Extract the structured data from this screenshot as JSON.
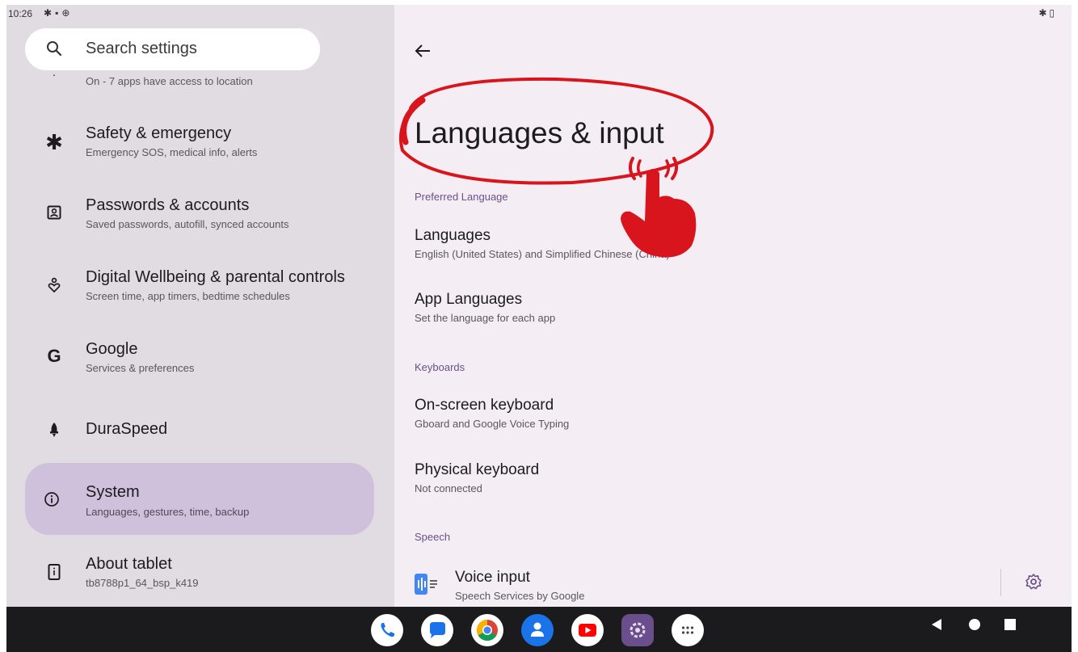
{
  "status_bar": {
    "time": "10:26"
  },
  "search": {
    "placeholder": "Search settings"
  },
  "left_list": {
    "partial_item_sub": "On - 7 apps have access to location",
    "items": [
      {
        "title": "Safety & emergency",
        "subtitle": "Emergency SOS, medical info, alerts",
        "icon": "asterisk-icon"
      },
      {
        "title": "Passwords & accounts",
        "subtitle": "Saved passwords, autofill, synced accounts",
        "icon": "account-box-icon"
      },
      {
        "title": "Digital Wellbeing & parental controls",
        "subtitle": "Screen time, app timers, bedtime schedules",
        "icon": "wellbeing-icon"
      },
      {
        "title": "Google",
        "subtitle": "Services & preferences",
        "icon": "google-icon"
      },
      {
        "title": "DuraSpeed",
        "subtitle": "",
        "icon": "rocket-icon"
      },
      {
        "title": "System",
        "subtitle": "Languages, gestures, time, backup",
        "icon": "info-icon",
        "selected": true
      },
      {
        "title": "About tablet",
        "subtitle": "tb8788p1_64_bsp_k419",
        "icon": "tablet-icon"
      }
    ]
  },
  "right_pane": {
    "title": "Languages & input",
    "sections": [
      {
        "header": "Preferred Language",
        "items": [
          {
            "title": "Languages",
            "subtitle": "English (United States) and Simplified Chinese (China)"
          },
          {
            "title": "App Languages",
            "subtitle": "Set the language for each app"
          }
        ]
      },
      {
        "header": "Keyboards",
        "items": [
          {
            "title": "On-screen keyboard",
            "subtitle": "Gboard and Google Voice Typing"
          },
          {
            "title": "Physical keyboard",
            "subtitle": "Not connected"
          }
        ]
      },
      {
        "header": "Speech",
        "items": [
          {
            "title": "Voice input",
            "subtitle": "Speech Services by Google"
          }
        ]
      }
    ]
  },
  "dock": {
    "apps": [
      "phone-icon",
      "messages-icon",
      "chrome-icon",
      "contacts-icon",
      "youtube-icon",
      "settings-icon",
      "app-drawer-icon"
    ]
  },
  "colors": {
    "left_bg": "#e1dbe2",
    "right_bg": "#f4eef4",
    "selected_bg": "#cfc0dc",
    "section_header": "#6b4f8c",
    "annotation_red": "#d8141c"
  }
}
